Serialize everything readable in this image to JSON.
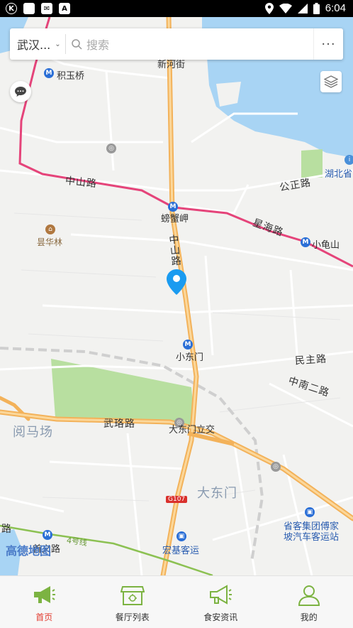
{
  "status_bar": {
    "time": "6:04",
    "left_icons": [
      "k-icon",
      "square-icon",
      "mail-icon",
      "a-icon"
    ]
  },
  "search": {
    "city": "武汉...",
    "placeholder": "搜索",
    "more": "···"
  },
  "map": {
    "labels": {
      "xinhe_street": "新河街",
      "jiyuqiao": "积玉桥",
      "zhongshan_road_west": "中山路",
      "gongzheng_road": "公正路",
      "pangxiejia": "螃蟹岬",
      "xinghai_road": "星海路",
      "xiaogui_shan": "小龟山",
      "hubei_province": "湖北省",
      "xianhualin": "昙华林",
      "zhongshan_road_vertical": "中山路",
      "xiaodongmen": "小东门",
      "minzhu_road": "民主路",
      "zhongnan_2nd_road": "中南二路",
      "yuemachang": "阅马场",
      "wuluo_road": "武珞路",
      "dadongmen_overpass": "大东门立交",
      "dadongmen": "大东门",
      "g107": "G107",
      "bus_station": "省客集团傅家坡汽车客运站",
      "bus_station_l1": "省客集团傅家",
      "bus_station_l2": "坡汽车客运站",
      "hongji_bus": "宏基客运",
      "shouyi_road": "首义路",
      "line4": "4号线",
      "lu_left": "路"
    },
    "logo": "高德地图"
  },
  "nav": {
    "items": [
      {
        "label": "首页",
        "icon": "megaphone-icon",
        "active": true
      },
      {
        "label": "餐厅列表",
        "icon": "restaurant-icon",
        "active": false
      },
      {
        "label": "食安资讯",
        "icon": "megaphone-outline-icon",
        "active": false
      },
      {
        "label": "我的",
        "icon": "user-icon",
        "active": false
      }
    ]
  },
  "colors": {
    "active": "#e23a2e",
    "nav_icon_green": "#7cb342",
    "water": "#a8d4f4",
    "park": "#b8dfa0",
    "metro_line": "#e5447a",
    "main_road": "#f3b25a"
  }
}
